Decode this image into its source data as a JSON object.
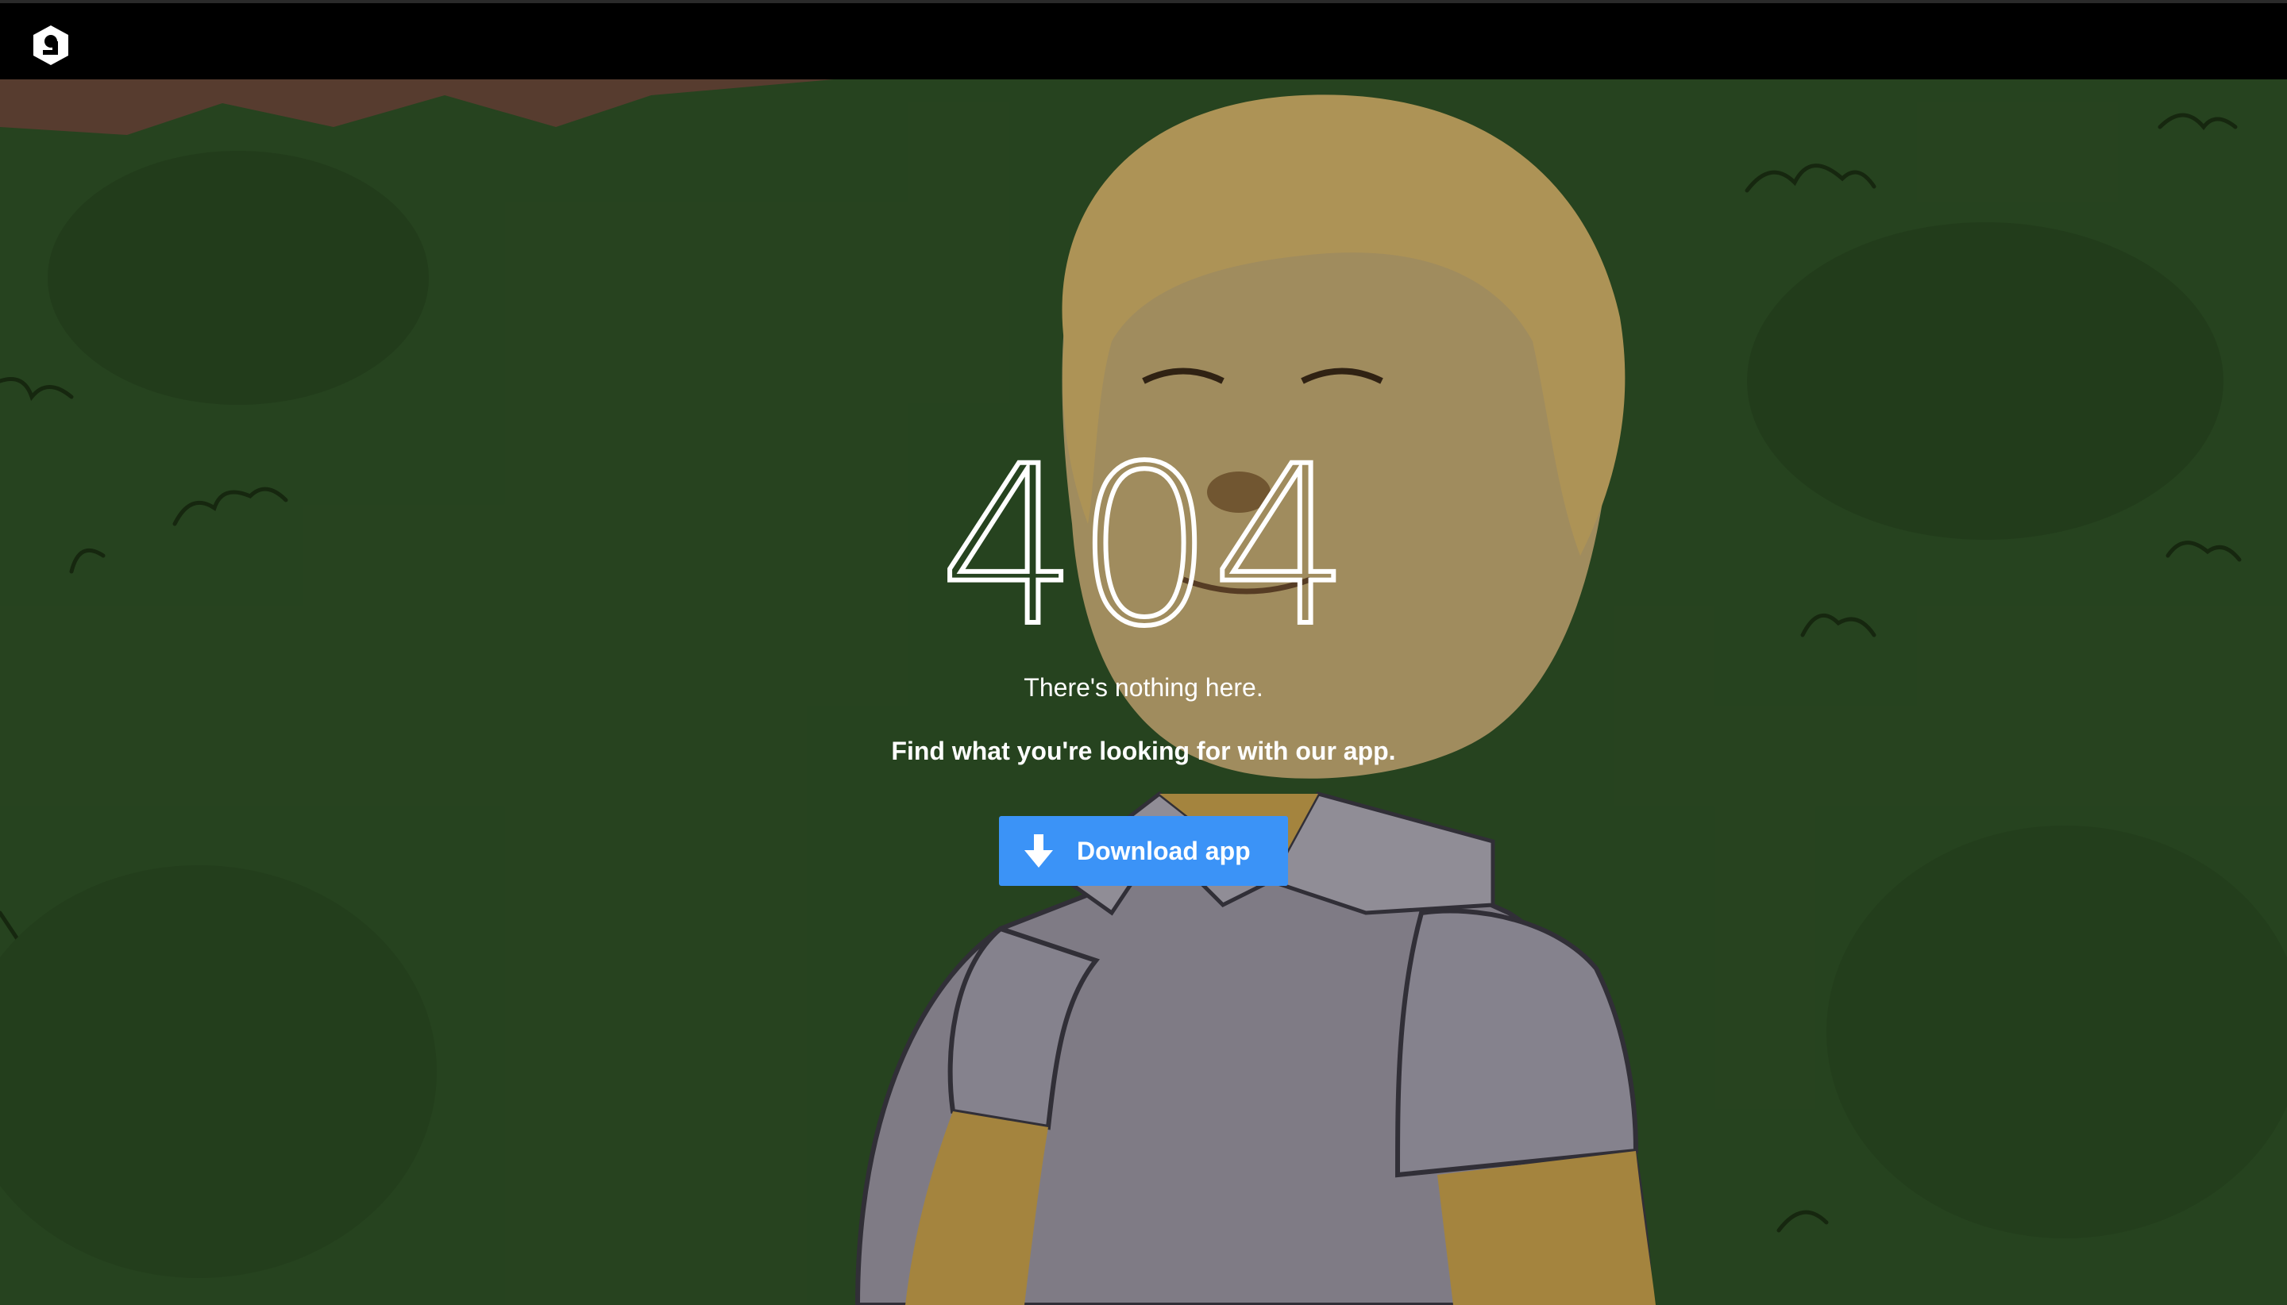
{
  "header": {
    "logo_icon": "9gag-logo-icon",
    "bg_color": "#000000"
  },
  "main": {
    "error_code": "404",
    "message": "There's nothing here.",
    "cta_text": "Find what you're looking for with our app.",
    "download_button": {
      "label": "Download app",
      "icon": "download-arrow-icon",
      "color": "#3B93F7"
    }
  },
  "background": {
    "description_colors": {
      "hedge": "#2B4A22",
      "skin": "#D7B466",
      "shirt": "#9B97A3"
    }
  }
}
